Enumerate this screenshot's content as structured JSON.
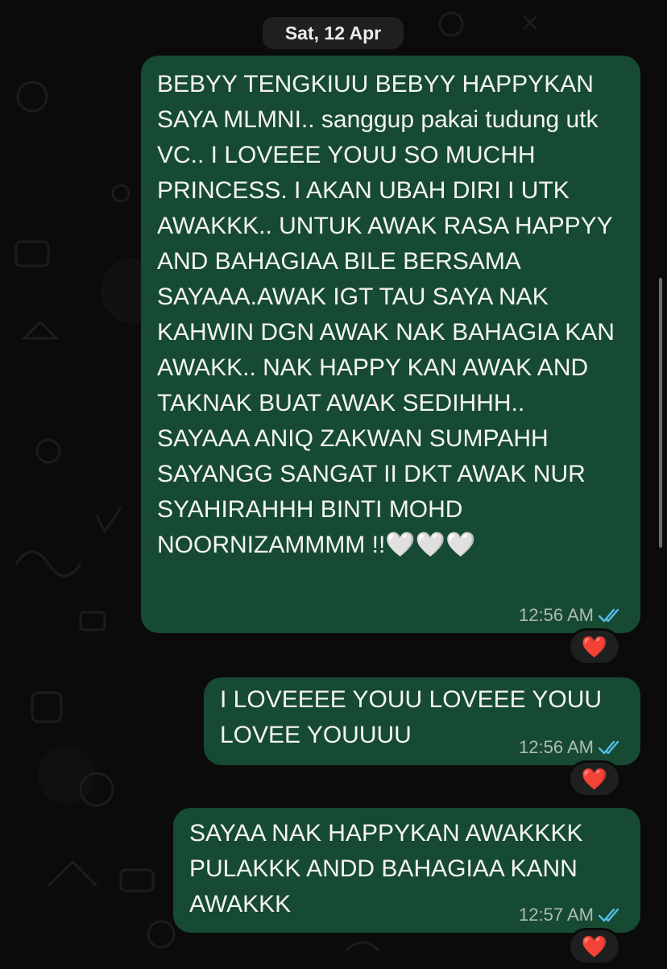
{
  "date_separator": "Sat, 12 Apr",
  "messages": [
    {
      "text": "BEBYY TENGKIUU BEBYY HAPPYKAN SAYA MLMNI.. sanggup pakai tudung utk VC.. I LOVEEE YOUU SO MUCHH PRINCESS. I AKAN UBAH DIRI I UTK AWAKKK.. UNTUK AWAK RASA HAPPYY AND BAHAGIAA BILE BERSAMA SAYAAA.AWAK IGT TAU SAYA NAK KAHWIN DGN AWAK NAK BAHAGIA KAN AWAKK.. NAK HAPPY KAN AWAK AND TAKNAK BUAT AWAK SEDIHHH.. SAYAAA ANIQ ZAKWAN SUMPAHH SAYANGG SANGAT II DKT AWAK NUR SYAHIRAHHH BINTI MOHD NOORNIZAMMMM !!🤍🤍🤍",
      "time": "12:56 AM",
      "status_icon": "double-check-read-icon",
      "reaction": "❤️"
    },
    {
      "text": "I LOVEEEE YOUU LOVEEE YOUU LOVEE YOUUUU",
      "time": "12:56 AM",
      "status_icon": "double-check-read-icon",
      "reaction": "❤️"
    },
    {
      "text": "SAYAA NAK HAPPYKAN AWAKKKK PULAKKK ANDD BAHAGIAA KANN AWAKKK",
      "time": "12:57 AM",
      "status_icon": "double-check-read-icon",
      "reaction": "❤️"
    }
  ],
  "colors": {
    "background": "#0b0b0b",
    "bubble": "#174a33",
    "read_ticks": "#53bdeb",
    "reaction_heart": "#e8232f"
  }
}
